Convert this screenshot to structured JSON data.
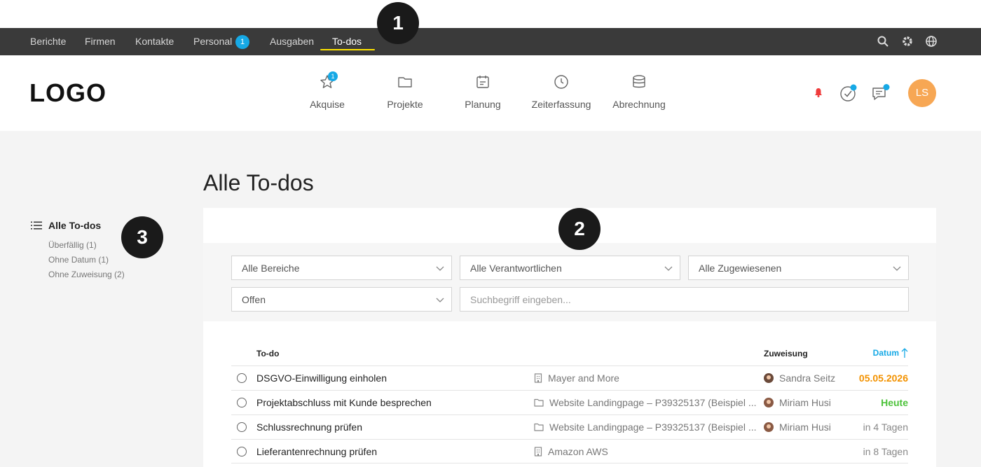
{
  "topnav": {
    "items": [
      "Berichte",
      "Firmen",
      "Kontakte",
      "Personal",
      "Ausgaben",
      "To-dos"
    ],
    "personal_badge": "1",
    "active": "To-dos"
  },
  "markers": {
    "m1": "1",
    "m2": "2",
    "m3": "3"
  },
  "header": {
    "logo": "LOGO",
    "modules": [
      {
        "label": "Akquise",
        "badge": "1"
      },
      {
        "label": "Projekte"
      },
      {
        "label": "Planung"
      },
      {
        "label": "Zeiterfassung"
      },
      {
        "label": "Abrechnung"
      }
    ],
    "avatar": "LS"
  },
  "page": {
    "title": "Alle To-dos"
  },
  "sidebar": {
    "main": "Alle To-dos",
    "subs": [
      "Überfällig (1)",
      "Ohne Datum (1)",
      "Ohne Zuweisung (2)"
    ]
  },
  "filters": {
    "bereiche": "Alle Bereiche",
    "verantwortliche": "Alle Verantwortlichen",
    "zugewiesene": "Alle Zugewiesenen",
    "status": "Offen",
    "search_placeholder": "Suchbegriff eingeben..."
  },
  "table": {
    "col_todo": "To-do",
    "col_assign": "Zuweisung",
    "col_date": "Datum",
    "rows": [
      {
        "title": "DSGVO-Einwilligung einholen",
        "ctx": "Mayer and More",
        "ctx_icon": "building-icon",
        "assign": "Sandra Seitz",
        "date": "05.05.2026"
      },
      {
        "title": "Projektabschluss mit Kunde besprechen",
        "ctx": "Website Landingpage – P39325137 (Beispiel ...",
        "ctx_icon": "folder-icon",
        "assign": "Miriam Husi",
        "date": "Heute"
      },
      {
        "title": "Schlussrechnung prüfen",
        "ctx": "Website Landingpage – P39325137 (Beispiel ...",
        "ctx_icon": "folder-icon",
        "assign": "Miriam Husi",
        "date": "in 4 Tagen"
      },
      {
        "title": "Lieferantenrechnung prüfen",
        "ctx": "Amazon AWS",
        "ctx_icon": "building-icon",
        "assign": "",
        "date": "in 8 Tagen"
      }
    ]
  },
  "colors": {
    "accent": "#16a9e6",
    "overdue": "#f39200",
    "today": "#4cc23a",
    "underline": "#ffe400",
    "avatar": "#f7a754"
  }
}
